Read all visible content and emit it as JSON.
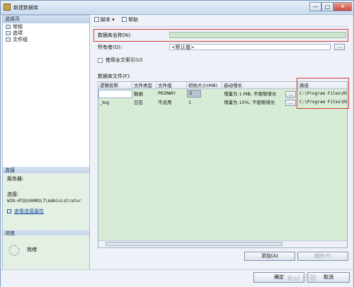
{
  "window": {
    "title": "新建数据库",
    "minimize": "—",
    "maximize": "□",
    "close": "✕"
  },
  "left": {
    "select_page_header": "选择页",
    "nav_items": [
      "常规",
      "选项",
      "文件组"
    ],
    "connection_header": "连接",
    "server_label": "服务器:",
    "connection_label": "连接:",
    "connection_value": "WIN-HTQSS00M2LT\\Administrator",
    "view_props_link": "查看连接属性",
    "progress_header": "进度",
    "progress_status": "就绪"
  },
  "toolbar": {
    "script_label": "脚本",
    "help_label": "帮助"
  },
  "form": {
    "dbname_label": "数据库名称(N):",
    "dbname_value": "",
    "owner_label": "所有者(O):",
    "owner_value": "<默认值>",
    "browse_button": "...",
    "fulltext_label": "使用全文索引(U)",
    "files_label": "数据库文件(F):"
  },
  "grid": {
    "columns": [
      "逻辑名称",
      "文件类型",
      "文件组",
      "初始大小(MB)",
      "自动增长",
      "路径"
    ],
    "rows": [
      {
        "name": "",
        "type": "数据",
        "group": "PRIMARY",
        "size": "3",
        "growth": "增量为 1 MB, 不限制增长",
        "path": "C:\\Program Files\\Mic"
      },
      {
        "name": "_log",
        "type": "日志",
        "group": "不适用",
        "size": "1",
        "growth": "增量为 10%, 不限制增长",
        "path": "C:\\Program Files\\Mic"
      }
    ],
    "cell_button": "..."
  },
  "buttons": {
    "add": "添加(A)",
    "remove": "删除(R)",
    "ok": "确定",
    "cancel": "取消"
  },
  "watermark": "Bai 经验"
}
